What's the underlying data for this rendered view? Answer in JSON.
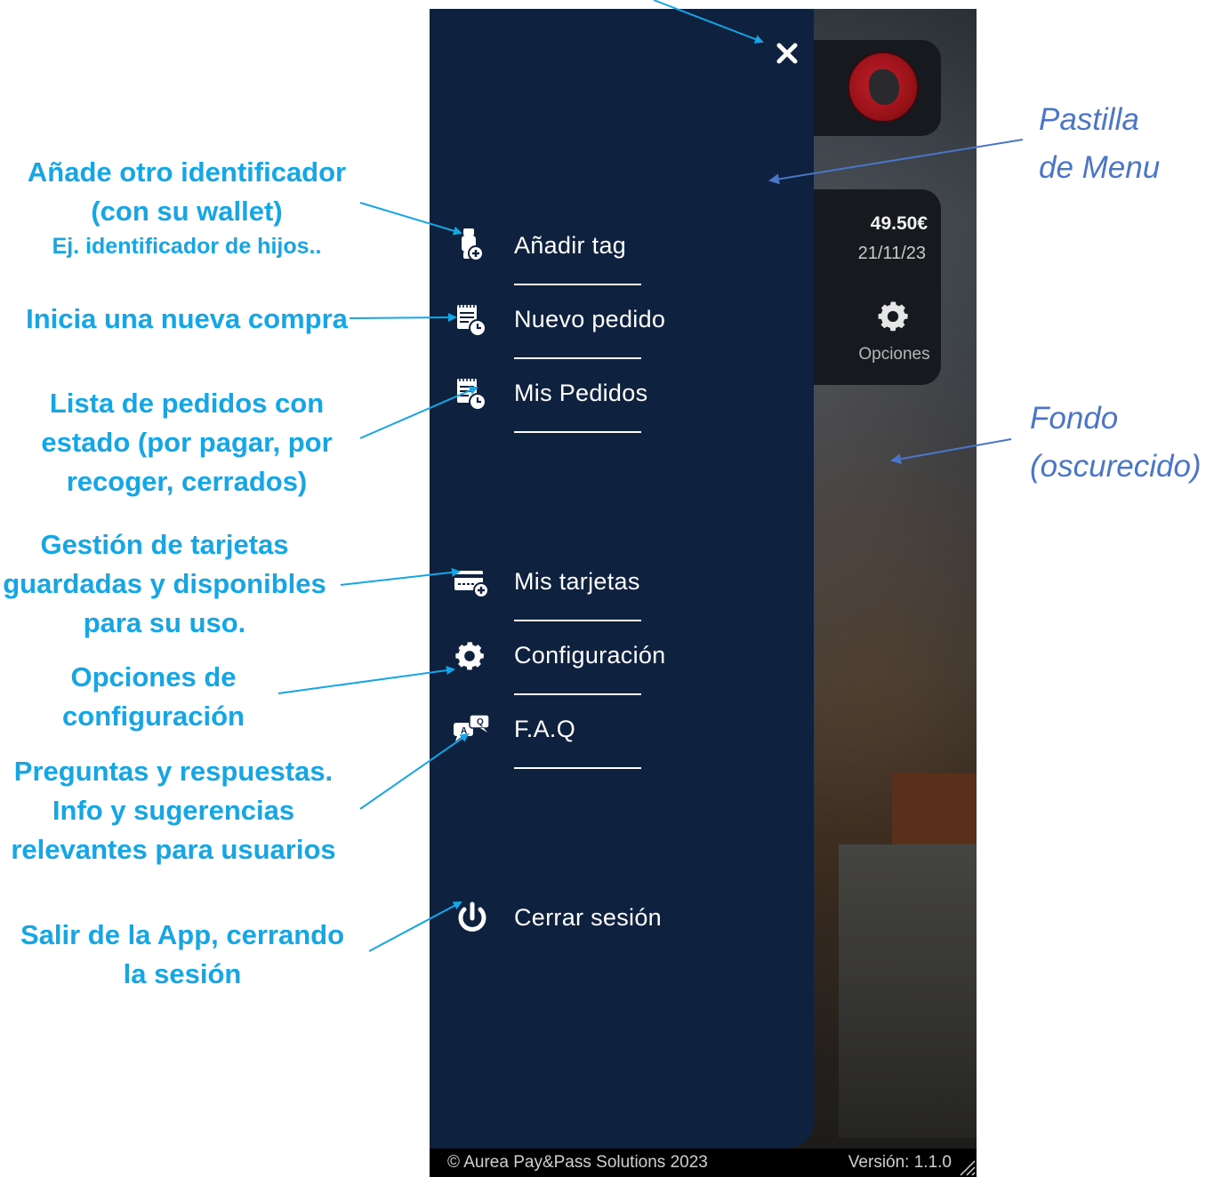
{
  "menu": {
    "items": [
      {
        "label": "Añadir tag",
        "icon": "watch-plus-icon"
      },
      {
        "label": "Nuevo pedido",
        "icon": "order-clock-icon"
      },
      {
        "label": "Mis Pedidos",
        "icon": "order-clock-icon"
      },
      {
        "label": "Mis tarjetas",
        "icon": "card-plus-icon"
      },
      {
        "label": "Configuración",
        "icon": "gear-icon"
      },
      {
        "label": "F.A.Q",
        "icon": "chat-bubbles-icon"
      },
      {
        "label": "Cerrar sesión",
        "icon": "power-icon"
      }
    ]
  },
  "background_app": {
    "balance": "49.50€",
    "date": "21/11/23",
    "options_label": "Opciones"
  },
  "footer": {
    "copyright": "© Aurea Pay&Pass Solutions 2023",
    "version": "Versión: 1.1.0"
  },
  "annotations": {
    "add_tag": {
      "line1": "Añade otro identificador",
      "line2": "(con su wallet)",
      "line3": "Ej. identificador de hijos.."
    },
    "new_order": "Inicia una nueva compra",
    "my_orders": {
      "line1": "Lista de pedidos con",
      "line2": "estado (por pagar, por",
      "line3": "recoger, cerrados)"
    },
    "my_cards": {
      "line1": "Gestión de tarjetas",
      "line2": "guardadas y disponibles",
      "line3": "para su uso."
    },
    "settings": {
      "line1": "Opciones de",
      "line2": "configuración"
    },
    "faq": {
      "line1": "Preguntas y respuestas.",
      "line2": "Info y sugerencias",
      "line3": "relevantes para usuarios"
    },
    "logout": {
      "line1": "Salir de la App, cerrando",
      "line2": "la sesión"
    },
    "menu_pill": {
      "line1": "Pastilla",
      "line2": "de Menu"
    },
    "background": {
      "line1": "Fondo",
      "line2": "(oscurecido)"
    }
  },
  "colors": {
    "drawer": "#0e2240",
    "annotation_blue": "#15a6e6",
    "italic_blue": "#4a76c9"
  }
}
